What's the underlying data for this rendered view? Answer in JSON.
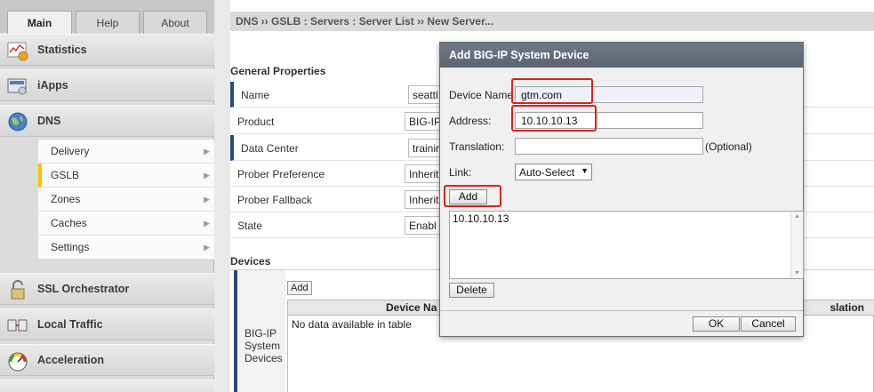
{
  "tabs": [
    "Main",
    "Help",
    "About"
  ],
  "nav": {
    "sections": [
      {
        "label": "Statistics",
        "icon": "statistics-icon"
      },
      {
        "label": "iApps",
        "icon": "iapps-icon"
      },
      {
        "label": "DNS",
        "icon": "globe-icon"
      },
      {
        "label": "SSL Orchestrator",
        "icon": "lock-icon"
      },
      {
        "label": "Local Traffic",
        "icon": "local-traffic-icon"
      },
      {
        "label": "Acceleration",
        "icon": "gauge-icon"
      }
    ],
    "dns_items": [
      "Delivery",
      "GSLB",
      "Zones",
      "Caches",
      "Settings"
    ]
  },
  "breadcrumb": "DNS  ››  GSLB : Servers : Server List  ››  New Server...",
  "general": {
    "title": "General Properties",
    "rows": [
      {
        "label": "Name",
        "value": "seattl"
      },
      {
        "label": "Product",
        "value": "BIG-IP"
      },
      {
        "label": "Data Center",
        "value": "trainin"
      },
      {
        "label": "Prober Preference",
        "value": "Inherit"
      },
      {
        "label": "Prober Fallback",
        "value": "Inherit"
      },
      {
        "label": "State",
        "value": "Enabl"
      }
    ]
  },
  "devices": {
    "title": "Devices",
    "left_label": "BIG-IP System Devices",
    "add_label": "Add",
    "col_device_name": "Device Na",
    "col_translation": "slation",
    "empty": "No data available in table"
  },
  "dialog": {
    "title": "Add BIG-IP System Device",
    "device_name_label": "Device Name",
    "device_name_value": "gtm.com",
    "address_label": "Address:",
    "address_value": "10.10.10.13",
    "translation_label": "Translation:",
    "translation_value": "",
    "optional_label": "(Optional)",
    "link_label": "Link:",
    "link_value": "Auto-Select",
    "add_button": "Add",
    "address_list": [
      "10.10.10.13"
    ],
    "delete_button": "Delete",
    "ok_button": "OK",
    "cancel_button": "Cancel"
  },
  "colors": {
    "highlight": "#e02020",
    "accent_blue": "#274b7a",
    "gslb_active": "#f5c400",
    "dialog_title": "#5f6975"
  }
}
